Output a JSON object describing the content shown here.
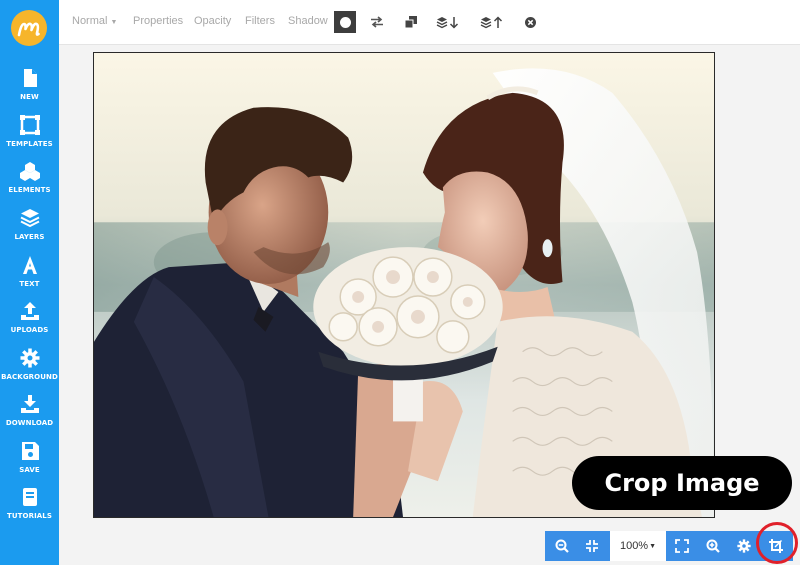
{
  "sidebar": {
    "items": [
      {
        "label": "NEW",
        "icon": "file-icon"
      },
      {
        "label": "TEMPLATES",
        "icon": "templates-icon"
      },
      {
        "label": "ELEMENTS",
        "icon": "elements-icon"
      },
      {
        "label": "LAYERS",
        "icon": "layers-icon"
      },
      {
        "label": "TEXT",
        "icon": "text-icon"
      },
      {
        "label": "UPLOADS",
        "icon": "upload-icon"
      },
      {
        "label": "BACKGROUND",
        "icon": "gear-icon"
      },
      {
        "label": "DOWNLOAD",
        "icon": "download-icon"
      },
      {
        "label": "SAVE",
        "icon": "save-icon"
      },
      {
        "label": "TUTORIALS",
        "icon": "book-icon"
      }
    ]
  },
  "toolbar": {
    "blend_mode": "Normal",
    "properties": "Properties",
    "opacity": "Opacity",
    "filters": "Filters",
    "shadow": "Shadow"
  },
  "tooltip": {
    "text": "Crop Image"
  },
  "bottom_bar": {
    "zoom": "100%"
  },
  "colors": {
    "sidebar": "#1b9bef",
    "accent": "#3a8ee6",
    "logo": "#f6b52b",
    "highlight": "#e0202a"
  }
}
